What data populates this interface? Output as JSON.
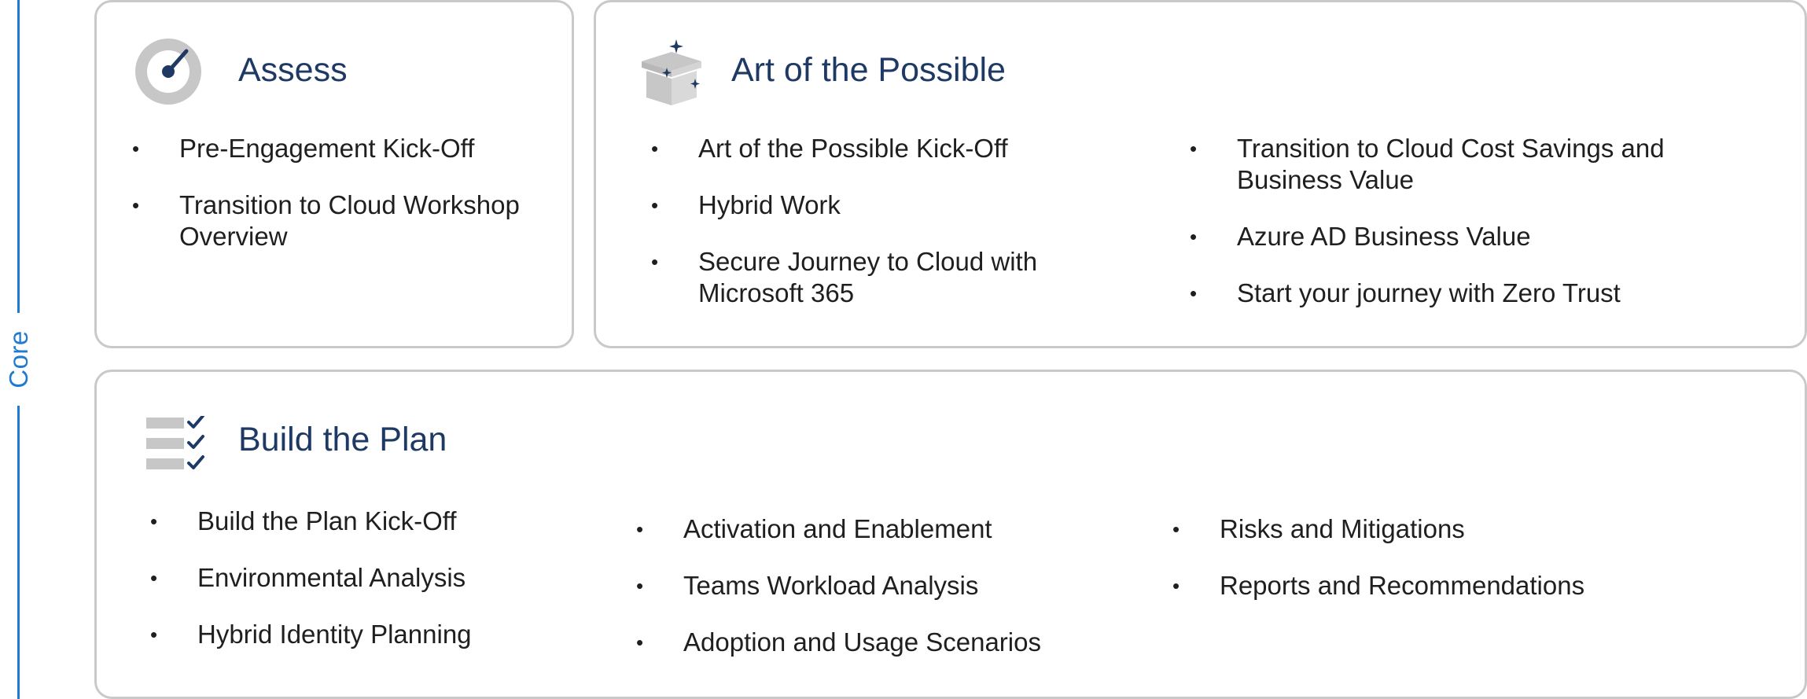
{
  "rail": {
    "label": "Core"
  },
  "assess": {
    "title": "Assess",
    "items": [
      "Pre-Engagement Kick-Off",
      "Transition to Cloud Workshop Overview"
    ]
  },
  "art_of_possible": {
    "title": "Art of the Possible",
    "columns": [
      [
        "Art of the Possible Kick-Off",
        "Hybrid Work",
        "Secure Journey to Cloud with Microsoft 365"
      ],
      [
        "Transition to Cloud Cost Savings and Business Value",
        "Azure AD Business Value",
        "Start your journey with Zero Trust"
      ]
    ]
  },
  "build_plan": {
    "title": "Build the Plan",
    "columns": [
      [
        "Build the Plan Kick-Off",
        "Environmental Analysis",
        "Hybrid Identity Planning"
      ],
      [
        "Activation and Enablement",
        "Teams Workload Analysis",
        "Adoption and Usage Scenarios"
      ],
      [
        "Risks and Mitigations",
        "Reports and Recommendations"
      ]
    ]
  },
  "colors": {
    "accent_blue": "#1f7bd1",
    "title_navy": "#1e3a64",
    "border_gray": "#c9c9c9",
    "icon_gray": "#c7c7c7"
  },
  "icons": {
    "assess": "gauge-icon",
    "art_of_possible": "gift-box-sparkle-icon",
    "build_plan": "checklist-icon"
  }
}
